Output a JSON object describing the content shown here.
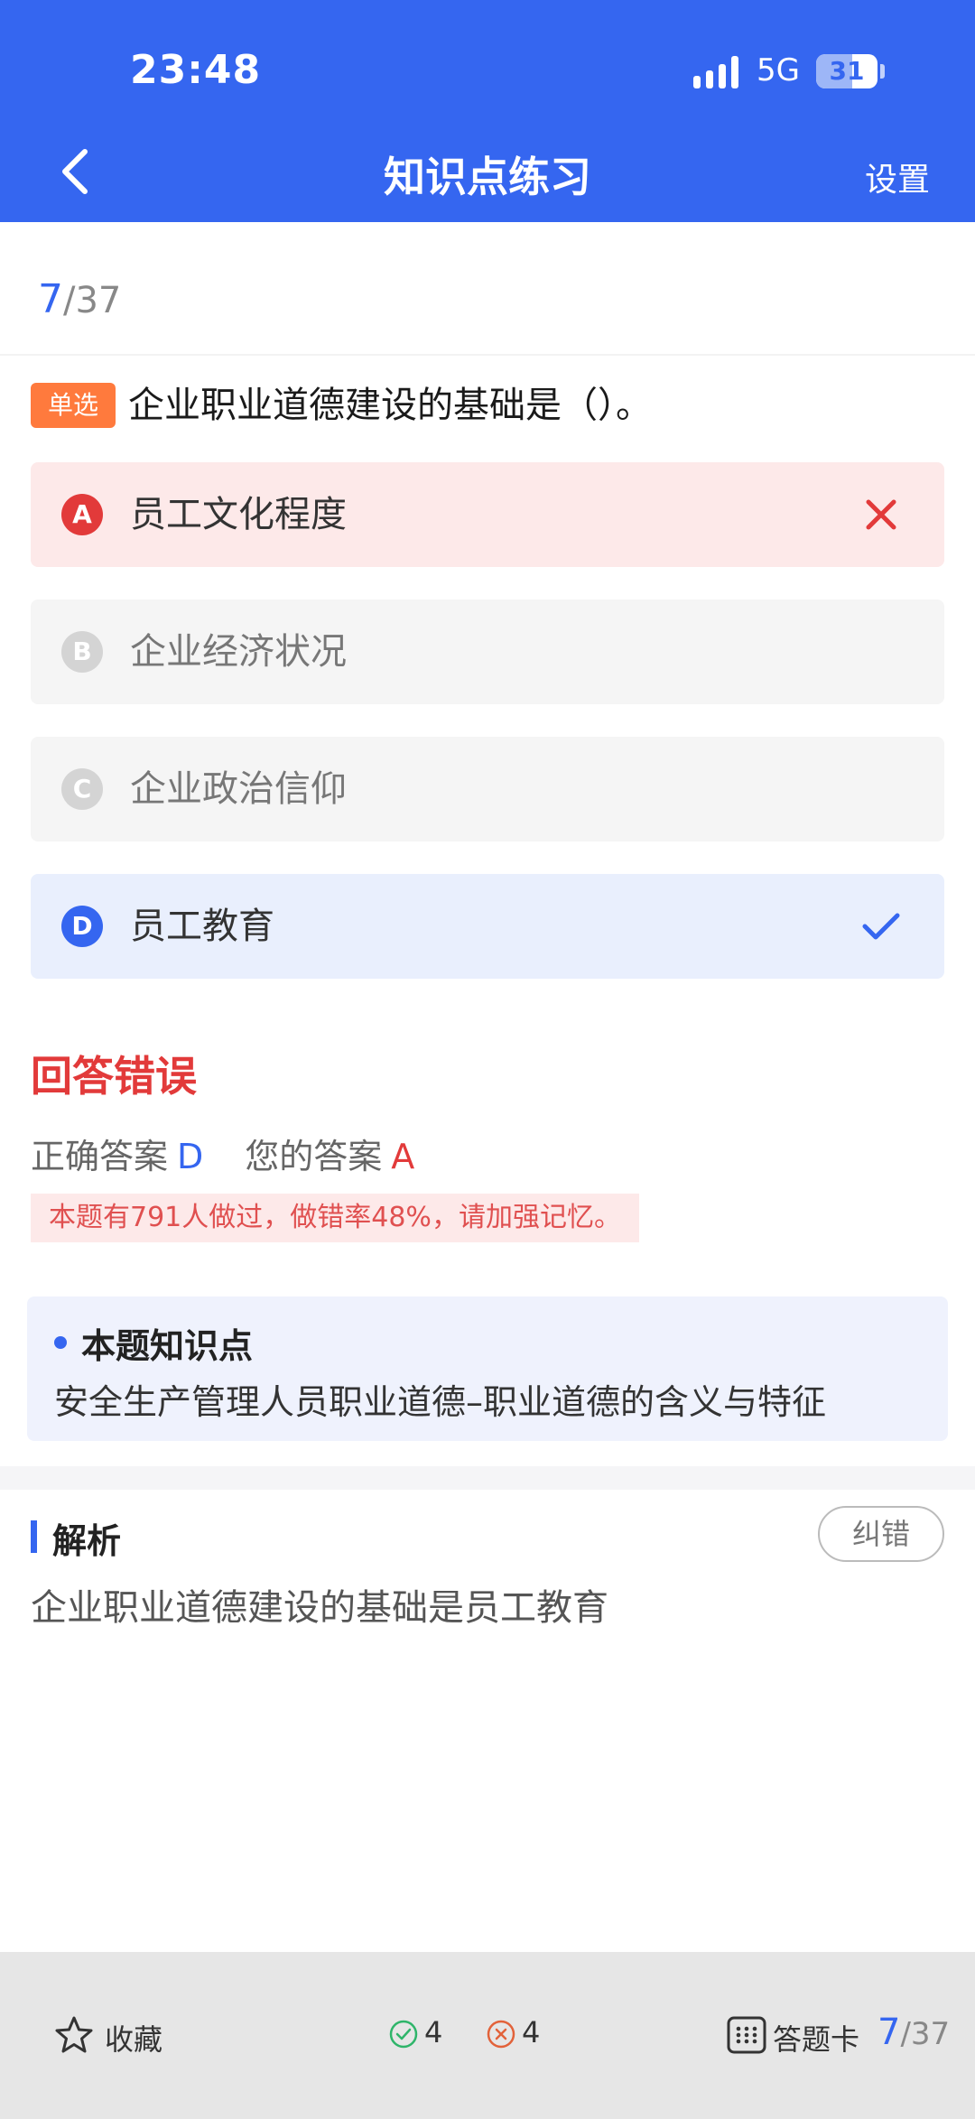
{
  "status_bar": {
    "time": "23:48",
    "network": "5G",
    "battery": "31"
  },
  "nav": {
    "title": "知识点练习",
    "settings_label": "设置"
  },
  "progress": {
    "current": "7",
    "total": "/37"
  },
  "question": {
    "type_badge": "单选",
    "text": "企业职业道德建设的基础是（）。",
    "options": [
      {
        "letter": "A",
        "text": "员工文化程度",
        "state": "wrong"
      },
      {
        "letter": "B",
        "text": "企业经济状况",
        "state": "normal"
      },
      {
        "letter": "C",
        "text": "企业政治信仰",
        "state": "normal"
      },
      {
        "letter": "D",
        "text": "员工教育",
        "state": "correct"
      }
    ]
  },
  "result": {
    "title": "回答错误",
    "correct_label": "正确答案",
    "correct_value": "D",
    "your_label": "您的答案",
    "your_value": "A",
    "stat_text": "本题有791人做过，做错率48%，请加强记忆。"
  },
  "knowledge_point": {
    "title": "本题知识点",
    "text": "安全生产管理人员职业道德–职业道德的含义与特征"
  },
  "analysis": {
    "title": "解析",
    "report_label": "纠错",
    "text": "企业职业道德建设的基础是员工教育"
  },
  "bottom_bar": {
    "favorite_label": "收藏",
    "correct_count": "4",
    "wrong_count": "4",
    "answer_card_label": "答题卡",
    "progress_current": "7",
    "progress_total": "/37"
  },
  "colors": {
    "primary": "#3566f0",
    "error": "#e23a3a",
    "badge_orange": "#ff7a3d",
    "correct_green": "#2fb56a"
  }
}
